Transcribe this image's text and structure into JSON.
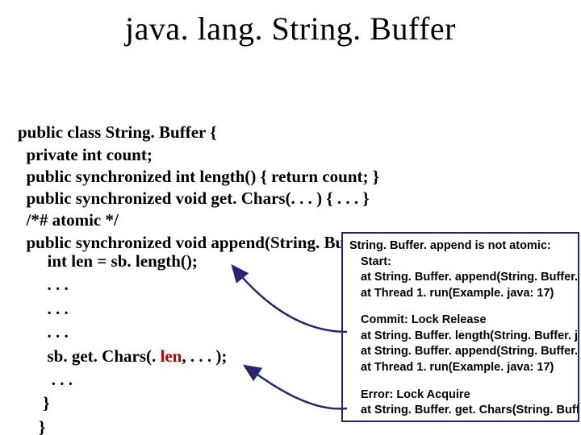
{
  "title": "java. lang. String. Buffer",
  "code": {
    "l1": "public class String. Buffer {",
    "l2": "  private int count;",
    "l3": "  public synchronized int length() { return count; }",
    "l4": "  public synchronized void get. Chars(. . . ) { . . . }",
    "l5": "  /*# atomic */",
    "l6": "  public synchronized void append(String. Buffer sb){"
  },
  "inner": {
    "l1": "  int len = sb. length();",
    "l2": "  . . .",
    "l3": "  . . .",
    "l4": "  . . .",
    "l5a": "  sb. get. Chars(. ",
    "l5b": "len",
    "l5c": ", . . . );",
    "l6": "   . . .",
    "l7": " }",
    "l8": "}"
  },
  "trace": {
    "t1": "String. Buffer. append is not atomic:",
    "t2": "Start:",
    "t3": "at String. Buffer. append(String. Buffer. jav",
    "t4": "at Thread 1. run(Example. java: 17)",
    "t5": "Commit: Lock Release",
    "t6": "at String. Buffer. length(String. Buffer. java",
    "t7": "at String. Buffer. append(String. Buffer. jav",
    "t8": "at Thread 1. run(Example. java: 17)",
    "t9": "Error: Lock Acquire",
    "t10": "at String. Buffer. get. Chars(String. Buffer. j"
  }
}
